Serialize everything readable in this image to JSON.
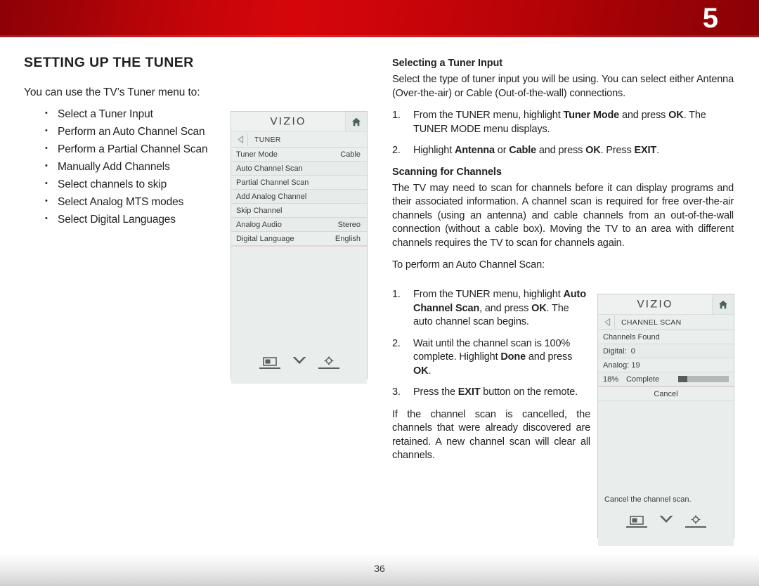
{
  "header": {
    "chapter_number": "5",
    "band_color_left": "#8d0106",
    "band_color_mid": "#d5060a",
    "band_color_right": "#8a0105"
  },
  "left": {
    "page_title": "SETTING UP THE TUNER",
    "intro": "You can use the TV’s Tuner menu to:",
    "bullets": [
      "Select a Tuner Input",
      "Perform an Auto Channel Scan",
      "Perform a Partial Channel Scan",
      "Manually Add Channels",
      "Select channels to skip",
      "Select Analog MTS modes",
      "Select Digital Languages"
    ]
  },
  "tuner_menu": {
    "logo": "VIZIO",
    "home_icon": "home-icon",
    "back_icon": "back-arrow-icon",
    "breadcrumb": "TUNER",
    "rows": [
      {
        "label": "Tuner Mode",
        "value": "Cable"
      },
      {
        "label": "Auto Channel Scan",
        "value": ""
      },
      {
        "label": "Partial Channel Scan",
        "value": ""
      },
      {
        "label": "Add Analog Channel",
        "value": ""
      },
      {
        "label": "Skip Channel",
        "value": ""
      },
      {
        "label": "Analog Audio",
        "value": "Stereo"
      },
      {
        "label": "Digital Language",
        "value": "English"
      }
    ],
    "footer_icons": [
      "picture-icon",
      "chevron-down-icon",
      "gear-icon"
    ]
  },
  "scan_menu": {
    "logo": "VIZIO",
    "home_icon": "home-icon",
    "back_icon": "back-arrow-icon",
    "breadcrumb": "CHANNEL SCAN",
    "channels_found_label": "Channels Found",
    "digital_label": "Digital:",
    "digital_value": "0",
    "analog_label": "Analog:",
    "analog_value": "19",
    "percent_label": "18%",
    "complete_label": "Complete",
    "progress_percent": 18,
    "cancel_label": "Cancel",
    "hint": "Cancel the channel scan.",
    "footer_icons": [
      "picture-icon",
      "chevron-down-icon",
      "gear-icon"
    ]
  },
  "right": {
    "section1_head": "Selecting a Tuner Input",
    "section1_para": "Select the type of tuner input you will be using. You can select either Antenna (Over-the-air) or Cable (Out-of-the-wall) connections.",
    "step1_num": "1.",
    "step1_a": "From the TUNER menu, highlight ",
    "step1_b": "Tuner Mode",
    "step1_c": " and press ",
    "step1_d": "OK",
    "step1_e": ". The TUNER MODE menu displays.",
    "step2_num": "2.",
    "step2_a": "Highlight ",
    "step2_b": "Antenna",
    "step2_c": " or ",
    "step2_d": "Cable",
    "step2_e": " and press ",
    "step2_f": "OK",
    "step2_g": ". Press ",
    "step2_h": "EXIT",
    "step2_i": ".",
    "section2_head": "Scanning for Channels",
    "section2_para": "The TV may need to scan for channels before it can display programs and their associated information. A channel scan is required for free over-the-air channels (using an antenna) and cable channels from an out-of-the-wall connection (without a cable box). Moving the TV to an area with different channels requires the TV to scan for channels again.",
    "section2_lead": "To perform an Auto Channel Scan:",
    "scan_step1_num": "1.",
    "scan_step1_a": "From the TUNER menu, highlight ",
    "scan_step1_b": "Auto Channel Scan",
    "scan_step1_c": ", and press ",
    "scan_step1_d": "OK",
    "scan_step1_e": ". The auto channel scan begins.",
    "scan_step2_num": "2.",
    "scan_step2_a": "Wait until the channel scan is 100% complete. Highlight ",
    "scan_step2_b": "Done",
    "scan_step2_c": " and press ",
    "scan_step2_d": "OK",
    "scan_step2_e": ".",
    "scan_step3_num": "3.",
    "scan_step3_a": "Press the ",
    "scan_step3_b": "EXIT",
    "scan_step3_c": " button on the remote.",
    "note_para": "If the channel scan is cancelled, the channels that were already discovered are retained. A new channel scan will clear all channels."
  },
  "footer": {
    "page_number": "36"
  }
}
